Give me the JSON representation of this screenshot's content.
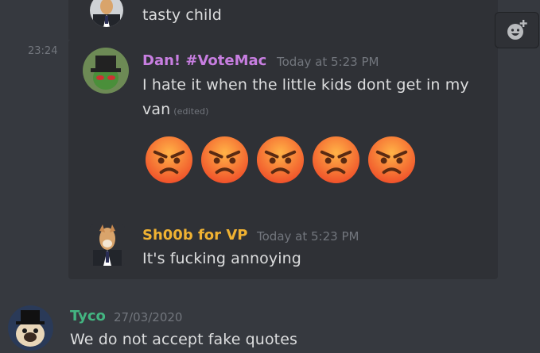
{
  "messages": [
    {
      "text": "tasty child"
    },
    {
      "side_time": "23:24",
      "author": "Dan! #VoteMac",
      "author_color": "#c77ee0",
      "timestamp": "Today at 5:23 PM",
      "text_line1": "I hate it when the little kids dont get in my",
      "text_line2": "van",
      "edited_label": "(edited)",
      "emoji_count": 5,
      "emoji_name": "angry-face"
    },
    {
      "author": "Sh00b for VP",
      "author_color": "#f0b232",
      "timestamp": "Today at 5:23 PM",
      "text": "It's fucking annoying"
    },
    {
      "author": "Tyco",
      "author_color": "#43b581",
      "timestamp": "27/03/2020",
      "text": "We do not accept fake quotes"
    }
  ],
  "colors": {
    "background": "#36393f",
    "quote_background": "#2f3136",
    "muted": "#72767d",
    "text": "#dcddde"
  },
  "icons": {
    "add_reaction": "add-reaction-icon"
  }
}
